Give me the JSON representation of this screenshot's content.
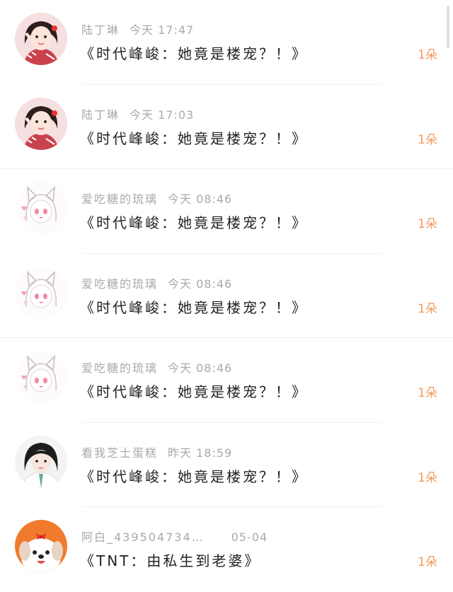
{
  "items": [
    {
      "name": "陆丁琳",
      "time": "今天 17:47",
      "title": "《时代峰峻：她竟是楼宠？！》",
      "gift": "1朵",
      "avatar": "girl-red-photo"
    },
    {
      "name": "陆丁琳",
      "time": "今天 17:03",
      "title": "《时代峰峻：她竟是楼宠？！》",
      "gift": "1朵",
      "avatar": "girl-red-photo"
    },
    {
      "name": "爱吃糖的琉璃",
      "time": "今天 08:46",
      "title": "《时代峰峻：她竟是楼宠？！》",
      "gift": "1朵",
      "avatar": "anime-cat-girl"
    },
    {
      "name": "爱吃糖的琉璃",
      "time": "今天 08:46",
      "title": "《时代峰峻：她竟是楼宠？！》",
      "gift": "1朵",
      "avatar": "anime-cat-girl"
    },
    {
      "name": "爱吃糖的琉璃",
      "time": "今天 08:46",
      "title": "《时代峰峻：她竟是楼宠？！》",
      "gift": "1朵",
      "avatar": "anime-cat-girl"
    },
    {
      "name": "看我芝士蛋糕",
      "time": "昨天 18:59",
      "title": "《时代峰峻：她竟是楼宠？！》",
      "gift": "1朵",
      "avatar": "girl-school-photo"
    },
    {
      "name": "阿白_439504734…",
      "time": "05-04",
      "title": "《TNT：由私生到老婆》",
      "gift": "1朵",
      "avatar": "cartoon-puppy"
    }
  ],
  "colors": {
    "gift": "#f39a5c",
    "meta": "#a9a9a9",
    "title": "#222222"
  }
}
